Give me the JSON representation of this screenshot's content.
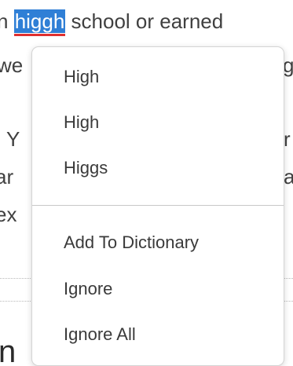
{
  "document": {
    "line1_before": "n ",
    "line1_misspelled": "higgh",
    "line1_after": " school or earned",
    "line2_left": "we",
    "line2_right": "g",
    "line3_left": ". Y",
    "line3_right": "r",
    "line4_left": "ar",
    "line4_right": "a",
    "line5_left": "ex",
    "heading_fragment": "n"
  },
  "context_menu": {
    "suggestions": [
      "High",
      "High",
      "Higgs"
    ],
    "add_to_dictionary": "Add To Dictionary",
    "ignore": "Ignore",
    "ignore_all": "Ignore All"
  },
  "colors": {
    "selection": "#2f7fd6",
    "spellcheck_underline": "#e03030"
  }
}
